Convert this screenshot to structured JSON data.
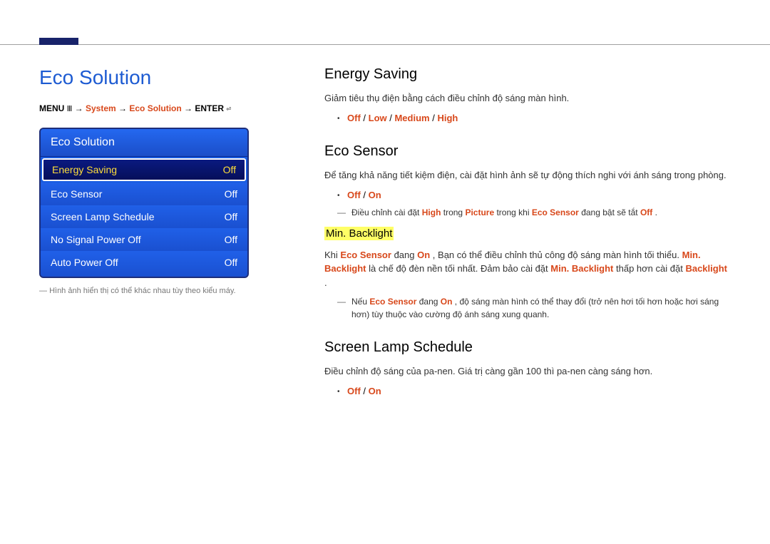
{
  "page_title": "Eco Solution",
  "breadcrumb": {
    "prefix": "MENU",
    "icon1": "Ⅲ",
    "arrow": " → ",
    "system": "System",
    "eco": "Eco Solution",
    "enter_label": "ENTER",
    "icon2": "⏎"
  },
  "panel": {
    "title": "Eco Solution",
    "rows": [
      {
        "label": "Energy Saving",
        "value": "Off",
        "selected": true
      },
      {
        "label": "Eco Sensor",
        "value": "Off",
        "selected": false
      },
      {
        "label": "Screen Lamp Schedule",
        "value": "Off",
        "selected": false
      },
      {
        "label": "No Signal Power Off",
        "value": "Off",
        "selected": false
      },
      {
        "label": "Auto Power Off",
        "value": "Off",
        "selected": false
      }
    ]
  },
  "panel_footnote": "Hình ảnh hiển thị có thể khác nhau tùy theo kiểu máy.",
  "right": {
    "s1": {
      "heading": "Energy Saving",
      "desc": "Giảm tiêu thụ điện bằng cách điều chỉnh độ sáng màn hình.",
      "opts": [
        "Off",
        "Low",
        "Medium",
        "High"
      ]
    },
    "s2": {
      "heading": "Eco Sensor",
      "desc": "Để tăng khả năng tiết kiệm điện, cài đặt hình ảnh sẽ tự động thích nghi với ánh sáng trong phòng.",
      "opts": [
        "Off",
        "On"
      ],
      "note_parts": {
        "pre": "Điều chỉnh cài đặt ",
        "high": "High",
        "mid1": " trong ",
        "picture": "Picture",
        "mid2": " trong khi ",
        "eco": "Eco Sensor",
        "post1": " đang bật sẽ tắt ",
        "off": "Off",
        "post2": "."
      },
      "sub_heading": "Min. Backlight",
      "sub_desc": {
        "pre": "Khi ",
        "eco": "Eco Sensor",
        "mid1": " đang ",
        "on": "On",
        "mid2": ", Bạn có thể điều chỉnh thủ công độ sáng màn hình tối thiểu. ",
        "mb": "Min. Backlight",
        "mid3": " là chế độ đèn nền tối nhất. Đảm bảo cài đặt ",
        "mb2": "Min. Backlight",
        "mid4": " thấp hơn cài đặt ",
        "bl": "Backlight",
        "post": "."
      },
      "sub_note": {
        "pre": "Nếu ",
        "eco": "Eco Sensor",
        "mid1": " đang ",
        "on": "On",
        "post": ", độ sáng màn hình có thể thay đổi (trở nên hơi tối hơn hoặc hơi sáng hơn) tùy thuộc vào cường độ ánh sáng xung quanh."
      }
    },
    "s3": {
      "heading": "Screen Lamp Schedule",
      "desc": "Điều chỉnh độ sáng của pa-nen. Giá trị càng gần 100 thì pa-nen càng sáng hơn.",
      "opts": [
        "Off",
        "On"
      ]
    }
  }
}
